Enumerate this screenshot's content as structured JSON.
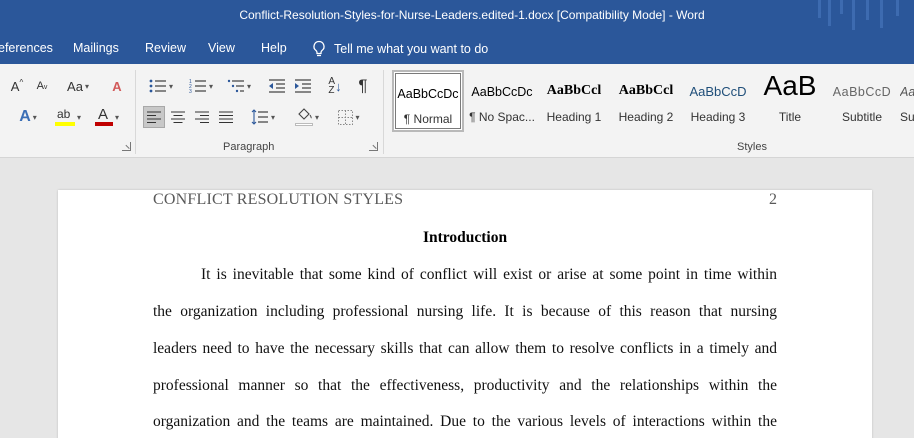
{
  "titlebar": {
    "title": "Conflict-Resolution-Styles-for-Nurse-Leaders.edited-1.docx [Compatibility Mode]  -  Word"
  },
  "ribbon_tabs": [
    "eferences",
    "Mailings",
    "Review",
    "View",
    "Help"
  ],
  "tell_me": {
    "icon": "lightbulb-icon",
    "label": "Tell me what you want to do"
  },
  "ribbon": {
    "font_group": {
      "grow_font": "A",
      "change_case": "Aa",
      "text_effects": "A",
      "highlight": "ab",
      "font_color": "A"
    },
    "paragraph_label": "Paragraph",
    "styles_label": "Styles",
    "show_marks": "¶"
  },
  "styles": [
    {
      "preview": "AaBbCcDc",
      "name": "¶ Normal",
      "selected": true
    },
    {
      "preview": "AaBbCcDc",
      "name": "¶ No Spac..."
    },
    {
      "preview": "AaBbCcl",
      "name": "Heading 1"
    },
    {
      "preview": "AaBbCcl",
      "name": "Heading 2"
    },
    {
      "preview": "AaBbCcD",
      "name": "Heading 3"
    },
    {
      "preview": "AaB",
      "name": "Title"
    },
    {
      "preview": "AaBbCcD",
      "name": "Subtitle"
    },
    {
      "preview": "Aa",
      "name": "Su"
    }
  ],
  "colors": {
    "word_blue": "#2b579a",
    "font_color_red": "#c00000",
    "highlight_yellow": "#ffff00",
    "heading3_blue": "#1f4e79"
  },
  "document": {
    "running_head": "CONFLICT RESOLUTION STYLES",
    "page_number": "2",
    "heading": "Introduction",
    "lines": [
      "It is inevitable that some kind of conflict will exist or arise at some point in time within",
      "the organization including professional nursing life. It is because of this reason that nursing",
      "leaders need to have the necessary skills that can allow them to resolve conflicts in a timely and",
      "professional manner so that the effectiveness, productivity and the relationships within the",
      "organization and the teams are maintained. Due to the various levels of interactions within the"
    ]
  }
}
